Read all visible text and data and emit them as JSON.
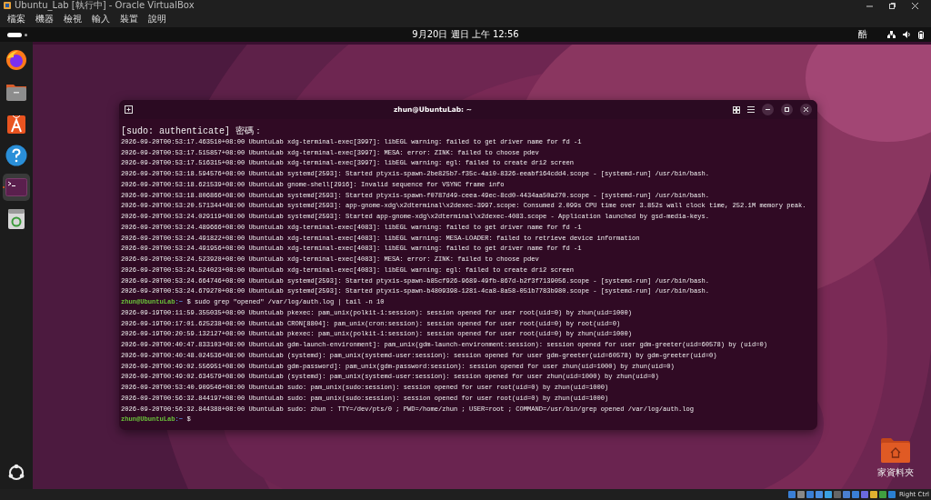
{
  "vbox_window": {
    "title": "Ubuntu_Lab [執行中] - Oracle VirtualBox"
  },
  "vbox_menu": [
    "檔案",
    "機器",
    "檢視",
    "輸入",
    "裝置",
    "說明"
  ],
  "top_bar": {
    "clock": "9月20日 週日 上午 12:56",
    "input_method": "酷"
  },
  "dock": {
    "apps": [
      {
        "kind": "firefox",
        "selected": false
      },
      {
        "kind": "files",
        "selected": false
      },
      {
        "kind": "app-center",
        "selected": false
      },
      {
        "kind": "help",
        "selected": false
      },
      {
        "kind": "terminal",
        "selected": true
      },
      {
        "kind": "trash",
        "selected": false
      }
    ]
  },
  "terminal": {
    "title": "zhun@UbuntuLab: ~",
    "lines": [
      {
        "kind": "password_prompt",
        "text": "[sudo: authenticate] 密碼："
      },
      {
        "kind": "output",
        "text": "2026-09-20T00:53:17.463510+08:00 UbuntuLab xdg-terminal-exec[3997]: libEGL warning: failed to get driver name for fd -1"
      },
      {
        "kind": "output",
        "text": "2026-09-20T00:53:17.515857+08:00 UbuntuLab xdg-terminal-exec[3997]: MESA: error: ZINK: failed to choose pdev"
      },
      {
        "kind": "output",
        "text": "2026-09-20T00:53:17.516315+08:00 UbuntuLab xdg-terminal-exec[3997]: libEGL warning: egl: failed to create dri2 screen"
      },
      {
        "kind": "output",
        "text": "2026-09-20T00:53:18.594576+08:00 UbuntuLab systemd[2593]: Started ptyxis-spawn-2be825b7-f35c-4a10-8326-eeabf164cdd4.scope - [systemd-run] /usr/bin/bash."
      },
      {
        "kind": "output",
        "text": "2026-09-20T00:53:18.621539+08:00 UbuntuLab gnome-shell[2916]: Invalid sequence for VSYNC frame info"
      },
      {
        "kind": "output",
        "text": "2026-09-20T00:53:18.806866+08:00 UbuntuLab systemd[2593]: Started ptyxis-spawn-f0787d49-ceea-49ec-8cd0-4434aa50a270.scope - [systemd-run] /usr/bin/bash."
      },
      {
        "kind": "output",
        "text": "2026-09-20T00:53:20.571344+08:00 UbuntuLab systemd[2593]: app-gnome-xdg\\x2dterminal\\x2dexec-3997.scope: Consumed 2.099s CPU time over 3.852s wall clock time, 252.1M memory peak."
      },
      {
        "kind": "output",
        "text": "2026-09-20T00:53:24.029119+08:00 UbuntuLab systemd[2593]: Started app-gnome-xdg\\x2dterminal\\x2dexec-4083.scope - Application launched by gsd-media-keys."
      },
      {
        "kind": "output",
        "text": "2026-09-20T00:53:24.489666+08:00 UbuntuLab xdg-terminal-exec[4083]: libEGL warning: failed to get driver name for fd -1"
      },
      {
        "kind": "output",
        "text": "2026-09-20T00:53:24.491822+08:00 UbuntuLab xdg-terminal-exec[4083]: libEGL warning: MESA-LOADER: failed to retrieve device information"
      },
      {
        "kind": "output",
        "text": "2026-09-20T00:53:24.491956+08:00 UbuntuLab xdg-terminal-exec[4083]: libEGL warning: failed to get driver name for fd -1"
      },
      {
        "kind": "output",
        "text": "2026-09-20T00:53:24.523928+08:00 UbuntuLab xdg-terminal-exec[4083]: MESA: error: ZINK: failed to choose pdev"
      },
      {
        "kind": "output",
        "text": "2026-09-20T00:53:24.524023+08:00 UbuntuLab xdg-terminal-exec[4083]: libEGL warning: egl: failed to create dri2 screen"
      },
      {
        "kind": "output",
        "text": "2026-09-20T00:53:24.664746+08:00 UbuntuLab systemd[2593]: Started ptyxis-spawn-b85cf926-9689-49fb-867d-b2f3f7139056.scope - [systemd-run] /usr/bin/bash."
      },
      {
        "kind": "output",
        "text": "2026-09-20T00:53:24.679270+08:00 UbuntuLab systemd[2593]: Started ptyxis-spawn-b4809398-1281-4ca8-8a58-051b7783b980.scope - [systemd-run] /usr/bin/bash."
      },
      {
        "kind": "prompt",
        "user": "zhun@UbuntuLab",
        "path": ":~",
        "command": "$ sudo grep \"opened\" /var/log/auth.log | tail -n 10"
      },
      {
        "kind": "output",
        "text": "2026-09-19T00:11:59.355035+08:00 UbuntuLab pkexec: pam_unix(polkit-1:session): session opened for user root(uid=0) by zhun(uid=1000)"
      },
      {
        "kind": "output",
        "text": "2026-09-19T00:17:01.625238+08:00 UbuntuLab CRON[8804]: pam_unix(cron:session): session opened for user root(uid=0) by root(uid=0)"
      },
      {
        "kind": "output",
        "text": "2026-09-19T00:20:59.132127+08:00 UbuntuLab pkexec: pam_unix(polkit-1:session): session opened for user root(uid=0) by zhun(uid=1000)"
      },
      {
        "kind": "output",
        "text": "2026-09-20T00:40:47.833103+08:00 UbuntuLab gdm-launch-environment]: pam_unix(gdm-launch-environment:session): session opened for user gdm-greeter(uid=60578) by (uid=0)"
      },
      {
        "kind": "output",
        "text": "2026-09-20T00:40:48.024536+08:00 UbuntuLab (systemd): pam_unix(systemd-user:session): session opened for user gdm-greeter(uid=60578) by gdm-greeter(uid=0)"
      },
      {
        "kind": "output",
        "text": "2026-09-20T00:49:02.556951+08:00 UbuntuLab gdm-password]: pam_unix(gdm-password:session): session opened for user zhun(uid=1000) by zhun(uid=0)"
      },
      {
        "kind": "output",
        "text": "2026-09-20T00:49:02.634579+08:00 UbuntuLab (systemd): pam_unix(systemd-user:session): session opened for user zhun(uid=1000) by zhun(uid=0)"
      },
      {
        "kind": "output",
        "text": "2026-09-20T00:53:40.909546+08:00 UbuntuLab sudo: pam_unix(sudo:session): session opened for user root(uid=0) by zhun(uid=1000)"
      },
      {
        "kind": "output",
        "text": "2026-09-20T00:56:32.844197+08:00 UbuntuLab sudo: pam_unix(sudo:session): session opened for user root(uid=0) by zhun(uid=1000)"
      },
      {
        "kind": "output",
        "text": "2026-09-20T00:56:32.844388+08:00 UbuntuLab sudo: zhun : TTY=/dev/pts/0 ; PWD=/home/zhun ; USER=root ; COMMAND=/usr/bin/grep opened /var/log/auth.log"
      },
      {
        "kind": "prompt",
        "user": "zhun@UbuntuLab",
        "path": ":~",
        "command": "$"
      }
    ]
  },
  "desktop_icons": [
    {
      "label": "家資料夾"
    }
  ],
  "vbox_status": {
    "host_key": "Right Ctrl"
  }
}
